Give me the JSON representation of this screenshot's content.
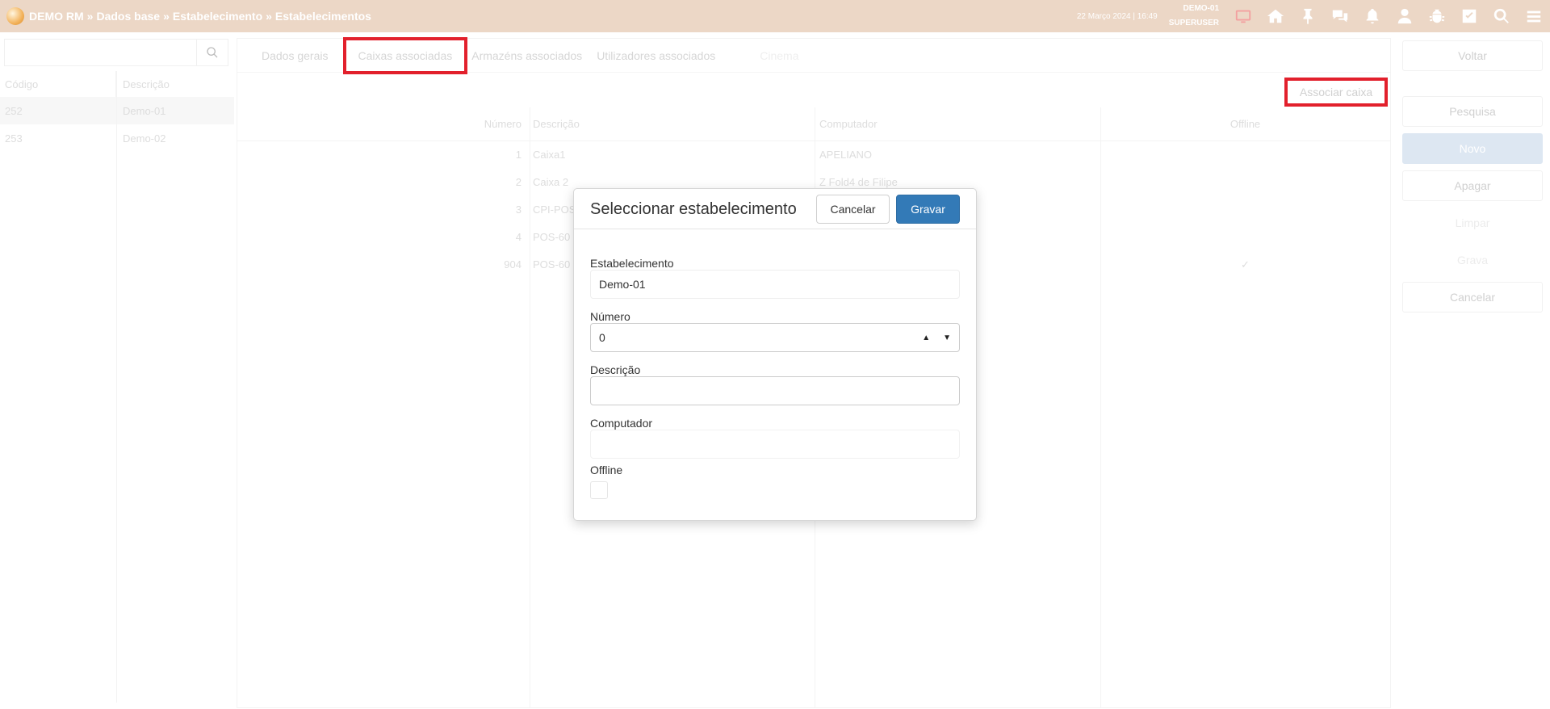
{
  "topbar": {
    "crumbs": [
      "DEMO RM",
      "Dados base",
      "Estabelecimento",
      "Estabelecimentos"
    ],
    "separator": "»",
    "datetime": "22 Março 2024 | 16:49",
    "user": {
      "store": "DEMO-01",
      "role": "SUPERUSER"
    },
    "icons": [
      "monitor-icon",
      "home-icon",
      "pin-icon",
      "chat-icon",
      "bell-icon",
      "user-icon",
      "bug-icon",
      "checkbox-icon",
      "search-icon",
      "menu-icon"
    ]
  },
  "left": {
    "search": {
      "value": "",
      "placeholder": ""
    },
    "columns": [
      "Código",
      "Descrição"
    ],
    "rows": [
      {
        "code": "252",
        "desc": "Demo-01"
      },
      {
        "code": "253",
        "desc": "Demo-02"
      }
    ]
  },
  "main": {
    "tabs": [
      "Dados gerais",
      "Caixas associadas",
      "Armazéns associados",
      "Utilizadores associados",
      "Cinema"
    ],
    "assoc_button": "Associar caixa",
    "columns": [
      "Número",
      "Descrição",
      "Computador",
      "Offline"
    ],
    "rows": [
      {
        "num": "1",
        "desc": "Caixa1",
        "comp": "APELIANO",
        "offline": ""
      },
      {
        "num": "2",
        "desc": "Caixa 2",
        "comp": "Z Fold4 de Filipe",
        "offline": ""
      },
      {
        "num": "3",
        "desc": "CPI-POS",
        "comp": "",
        "offline": ""
      },
      {
        "num": "4",
        "desc": "POS-60",
        "comp": "",
        "offline": ""
      },
      {
        "num": "904",
        "desc": "POS-60",
        "comp": "",
        "offline": "✓"
      }
    ]
  },
  "right": {
    "buttons": [
      "Voltar",
      "Pesquisa",
      "Novo",
      "Apagar",
      "Limpar",
      "Grava",
      "Cancelar"
    ]
  },
  "modal": {
    "title": "Seleccionar estabelecimento",
    "cancel": "Cancelar",
    "save": "Gravar",
    "fields": {
      "estabelecimento": {
        "label": "Estabelecimento",
        "value": "Demo-01"
      },
      "numero": {
        "label": "Número",
        "value": "0"
      },
      "descricao": {
        "label": "Descrição",
        "value": ""
      },
      "computador": {
        "label": "Computador",
        "value": ""
      },
      "offline": {
        "label": "Offline",
        "checked": false
      }
    }
  }
}
